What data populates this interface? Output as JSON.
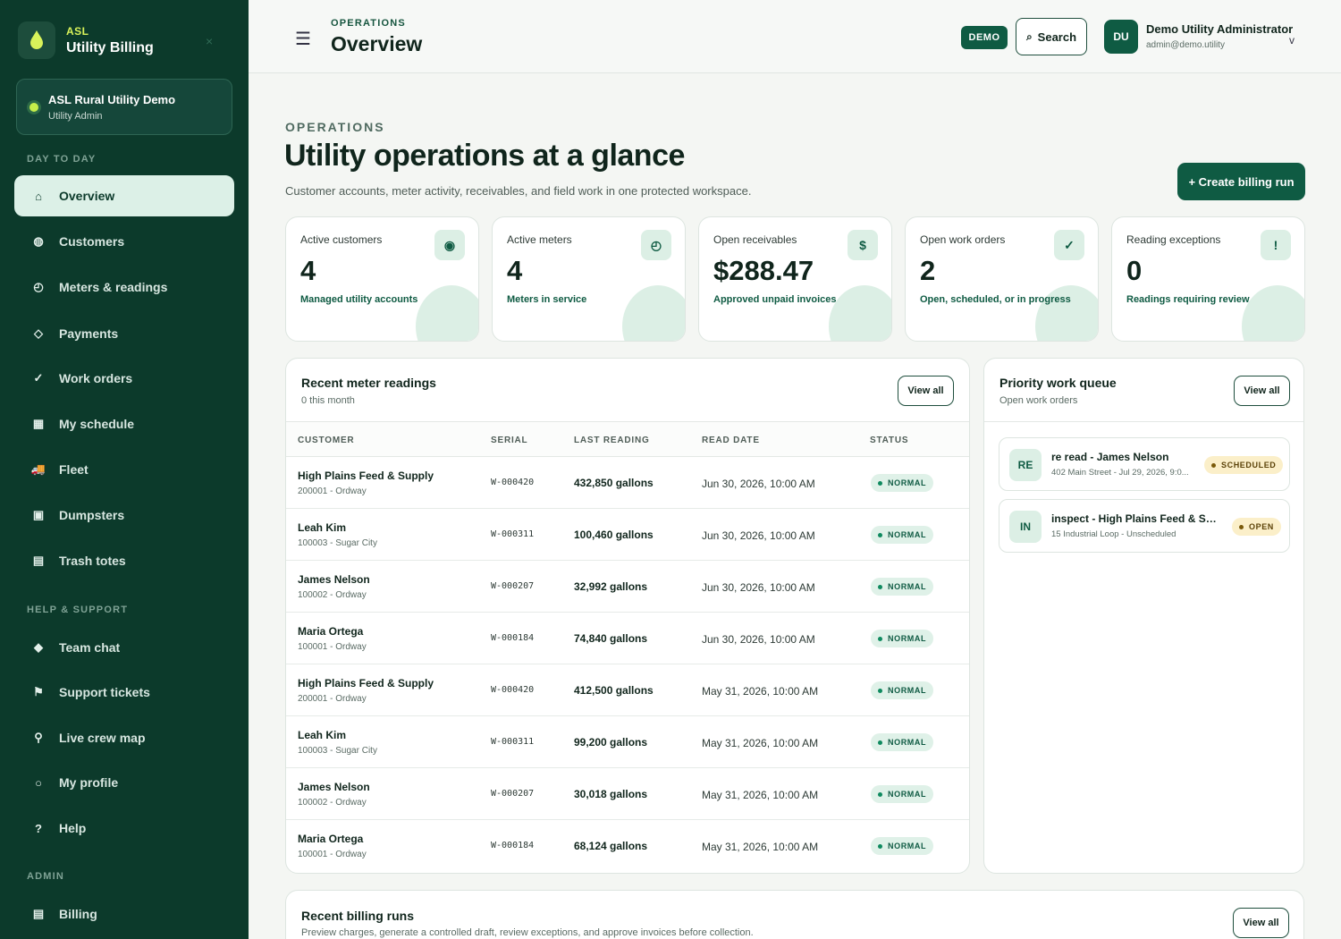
{
  "brand": {
    "small": "ASL",
    "title": "Utility Billing",
    "close_icon": "×"
  },
  "org": {
    "name": "ASL Rural Utility Demo",
    "role": "Utility Admin"
  },
  "sidebar": {
    "sections": [
      "DAY TO DAY",
      "HELP & SUPPORT",
      "ADMIN"
    ],
    "items": [
      {
        "label": "Overview",
        "icon": "⌂"
      },
      {
        "label": "Customers",
        "icon": "◍"
      },
      {
        "label": "Meters & readings",
        "icon": "◴"
      },
      {
        "label": "Payments",
        "icon": "◇"
      },
      {
        "label": "Work orders",
        "icon": "✓"
      },
      {
        "label": "My schedule",
        "icon": "▦"
      },
      {
        "label": "Fleet",
        "icon": "🚚"
      },
      {
        "label": "Dumpsters",
        "icon": "▣"
      },
      {
        "label": "Trash totes",
        "icon": "▤"
      },
      {
        "label": "Team chat",
        "icon": "◆"
      },
      {
        "label": "Support tickets",
        "icon": "⚑"
      },
      {
        "label": "Live crew map",
        "icon": "⚲"
      },
      {
        "label": "My profile",
        "icon": "○"
      },
      {
        "label": "Help",
        "icon": "?"
      },
      {
        "label": "Billing",
        "icon": "▤"
      }
    ]
  },
  "topbar": {
    "menu_icon": "☰",
    "eyebrow": "OPERATIONS",
    "title": "Overview",
    "demo_badge": "DEMO",
    "search_icon": "⌕",
    "search_label": "Search",
    "avatar_initials": "DU",
    "user_name": "Demo Utility Administrator",
    "user_email": "admin@demo.utility",
    "user_chevron": "v"
  },
  "hero": {
    "eyebrow": "OPERATIONS",
    "title": "Utility operations at a glance",
    "subtitle": "Customer accounts, meter activity, receivables, and field work in one protected workspace.",
    "create_button": "+ Create billing run"
  },
  "kpis": [
    {
      "label": "Active customers",
      "value": "4",
      "desc": "Managed utility accounts",
      "icon": "◉"
    },
    {
      "label": "Active meters",
      "value": "4",
      "desc": "Meters in service",
      "icon": "◴"
    },
    {
      "label": "Open receivables",
      "value": "$288.47",
      "desc": "Approved unpaid invoices",
      "icon": "$"
    },
    {
      "label": "Open work orders",
      "value": "2",
      "desc": "Open, scheduled, or in progress",
      "icon": "✓"
    },
    {
      "label": "Reading exceptions",
      "value": "0",
      "desc": "Readings requiring review",
      "icon": "!"
    }
  ],
  "readings": {
    "title": "Recent meter readings",
    "subtitle": "0 this month",
    "view_all": "View all",
    "columns": [
      "CUSTOMER",
      "SERIAL",
      "LAST READING",
      "READ DATE",
      "STATUS"
    ],
    "rows": [
      {
        "name": "High Plains Feed & Supply",
        "sub": "200001 - Ordway",
        "serial": "W-000420",
        "reading": "432,850 gallons",
        "date": "Jun 30, 2026, 10:00 AM",
        "status": "NORMAL"
      },
      {
        "name": "Leah Kim",
        "sub": "100003 - Sugar City",
        "serial": "W-000311",
        "reading": "100,460 gallons",
        "date": "Jun 30, 2026, 10:00 AM",
        "status": "NORMAL"
      },
      {
        "name": "James Nelson",
        "sub": "100002 - Ordway",
        "serial": "W-000207",
        "reading": "32,992 gallons",
        "date": "Jun 30, 2026, 10:00 AM",
        "status": "NORMAL"
      },
      {
        "name": "Maria Ortega",
        "sub": "100001 - Ordway",
        "serial": "W-000184",
        "reading": "74,840 gallons",
        "date": "Jun 30, 2026, 10:00 AM",
        "status": "NORMAL"
      },
      {
        "name": "High Plains Feed & Supply",
        "sub": "200001 - Ordway",
        "serial": "W-000420",
        "reading": "412,500 gallons",
        "date": "May 31, 2026, 10:00 AM",
        "status": "NORMAL"
      },
      {
        "name": "Leah Kim",
        "sub": "100003 - Sugar City",
        "serial": "W-000311",
        "reading": "99,200 gallons",
        "date": "May 31, 2026, 10:00 AM",
        "status": "NORMAL"
      },
      {
        "name": "James Nelson",
        "sub": "100002 - Ordway",
        "serial": "W-000207",
        "reading": "30,018 gallons",
        "date": "May 31, 2026, 10:00 AM",
        "status": "NORMAL"
      },
      {
        "name": "Maria Ortega",
        "sub": "100001 - Ordway",
        "serial": "W-000184",
        "reading": "68,124 gallons",
        "date": "May 31, 2026, 10:00 AM",
        "status": "NORMAL"
      }
    ]
  },
  "queue": {
    "title": "Priority work queue",
    "subtitle": "Open work orders",
    "view_all": "View all",
    "items": [
      {
        "badge": "RE",
        "title": "re read - James Nelson",
        "sub": "402 Main Street - Jul 29, 2026, 9:0...",
        "status": "SCHEDULED"
      },
      {
        "badge": "IN",
        "title": "inspect - High Plains Feed & Sup...",
        "sub": "15 Industrial Loop - Unscheduled",
        "status": "OPEN"
      }
    ]
  },
  "billing_runs": {
    "title": "Recent billing runs",
    "subtitle": "Preview charges, generate a controlled draft, review exceptions, and approve invoices before collection.",
    "view_all": "View all"
  }
}
